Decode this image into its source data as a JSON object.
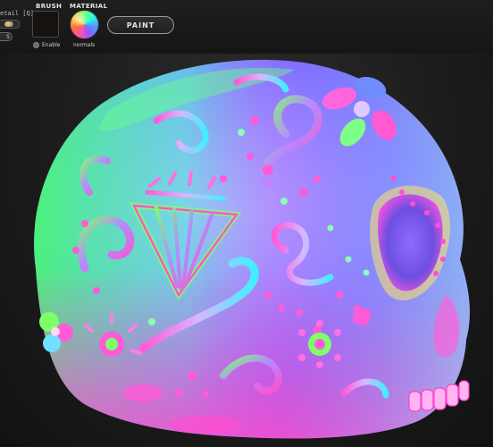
{
  "toolbar": {
    "detail_label": "etail [Q]",
    "detail_value": "5",
    "brush": {
      "label": "BRUSH",
      "enable_label": "Enable"
    },
    "material": {
      "label": "MATERIAL",
      "name": "normals"
    },
    "paint_label": "PAINT"
  },
  "viewport": {
    "model": "sugar-skull",
    "shading": "normals",
    "colors": {
      "background": "#1b1b1b",
      "violet": "#b07cff",
      "blue": "#6f7bff",
      "green": "#4dff6a",
      "magenta": "#ff4fd0",
      "cyan": "#3fe8ff"
    }
  }
}
